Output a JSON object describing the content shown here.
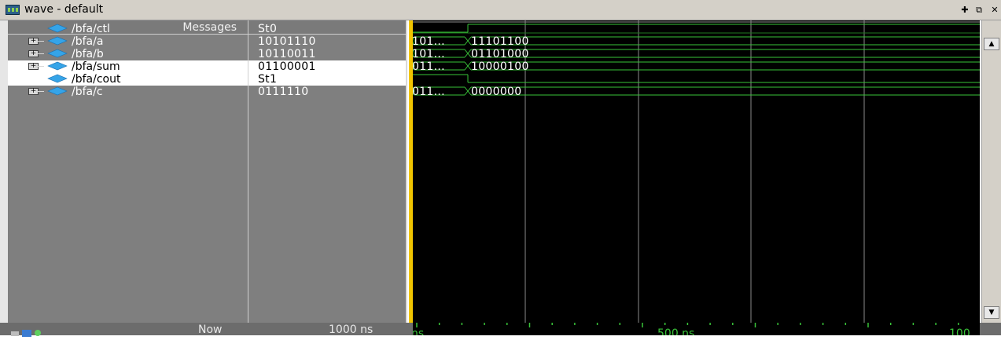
{
  "window": {
    "title": "wave - default"
  },
  "columns": {
    "messages": "Messages"
  },
  "signals": [
    {
      "name": "/bfa/ctl",
      "value": "St0",
      "expandable": false,
      "selected": false,
      "wave": "bit",
      "seg1": "",
      "seg2": ""
    },
    {
      "name": "/bfa/a",
      "value": "10101110",
      "expandable": true,
      "selected": false,
      "wave": "bus",
      "seg1": "101...",
      "seg2": "11101100"
    },
    {
      "name": "/bfa/b",
      "value": "10110011",
      "expandable": true,
      "selected": false,
      "wave": "bus",
      "seg1": "101...",
      "seg2": "01101000"
    },
    {
      "name": "/bfa/sum",
      "value": "01100001",
      "expandable": true,
      "selected": true,
      "wave": "bus",
      "seg1": "011...",
      "seg2": "10000100"
    },
    {
      "name": "/bfa/cout",
      "value": "St1",
      "expandable": false,
      "selected": true,
      "wave": "bit",
      "seg1": "",
      "seg2": ""
    },
    {
      "name": "/bfa/c",
      "value": "0111110",
      "expandable": true,
      "selected": false,
      "wave": "bus",
      "seg1": "011...",
      "seg2": "0000000"
    }
  ],
  "status": {
    "now_label": "Now",
    "now_value": "1000 ns"
  },
  "timeline": {
    "start_label": "ns",
    "mid_label": "500 ns",
    "end_label": "100"
  },
  "colors": {
    "wave": "#39c339",
    "cursor": "#f0c400",
    "background": "#000000",
    "panel": "#7f7f7f"
  },
  "icons": [
    "wave-window-icon",
    "signal-diamond-icon",
    "expand-plus-icon",
    "scroll-up-icon",
    "scroll-down-icon"
  ]
}
